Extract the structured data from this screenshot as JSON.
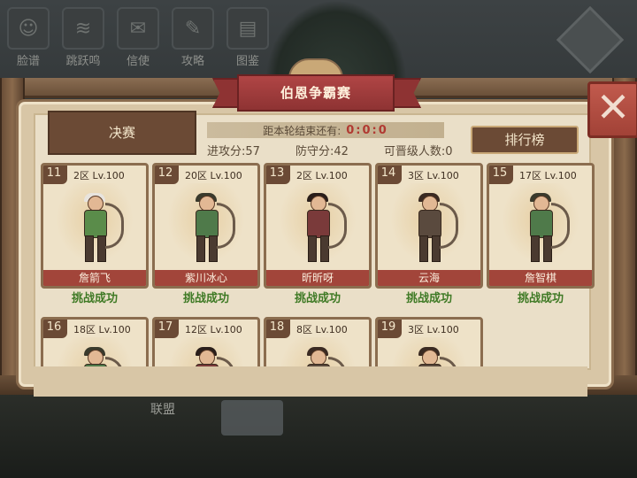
{
  "top_menu": [
    {
      "label": "脸谱",
      "icon": "mask-icon"
    },
    {
      "label": "跳跃鸣",
      "icon": "scroll-icon"
    },
    {
      "label": "信使",
      "icon": "letter-icon"
    },
    {
      "label": "攻略",
      "icon": "book-icon"
    },
    {
      "label": "图鉴",
      "icon": "album-icon"
    }
  ],
  "bottom_label": "联盟",
  "title": "伯恩争霸赛",
  "stage_tab": "决赛",
  "timer": {
    "label": "距本轮结束还有:",
    "value": "0:0:0"
  },
  "stats": {
    "attack": "进攻分:57",
    "defense": "防守分:42",
    "promotable": "可晋级人数:0"
  },
  "rank_button": "排行榜",
  "close_label": "✕",
  "cards": [
    {
      "num": "11",
      "server": "2区 Lv.100",
      "name": "詹箭飞",
      "status": "挑战成功",
      "hair": "#e8e4de",
      "outfit": "#5a8c4a"
    },
    {
      "num": "12",
      "server": "20区 Lv.100",
      "name": "紫川冰心",
      "status": "挑战成功",
      "hair": "#3a3a2c",
      "outfit": "#4f7a4a"
    },
    {
      "num": "13",
      "server": "2区 Lv.100",
      "name": "昕昕呀",
      "status": "挑战成功",
      "hair": "#2a1e1a",
      "outfit": "#7a3a3a"
    },
    {
      "num": "14",
      "server": "3区 Lv.100",
      "name": "云海",
      "status": "挑战成功",
      "hair": "#3a2a22",
      "outfit": "#5a4a3e"
    },
    {
      "num": "15",
      "server": "17区 Lv.100",
      "name": "詹智棋",
      "status": "挑战成功",
      "hair": "#3a3a2c",
      "outfit": "#4f7a4a"
    },
    {
      "num": "16",
      "server": "18区 Lv.100",
      "name": "",
      "status": "",
      "hair": "#3a3a2c",
      "outfit": "#4f7a4a"
    },
    {
      "num": "17",
      "server": "12区 Lv.100",
      "name": "",
      "status": "",
      "hair": "#2a1e1a",
      "outfit": "#7a3a3a"
    },
    {
      "num": "18",
      "server": "8区 Lv.100",
      "name": "",
      "status": "",
      "hair": "#3a2a22",
      "outfit": "#5a4a3e"
    },
    {
      "num": "19",
      "server": "3区 Lv.100",
      "name": "",
      "status": "",
      "hair": "#3a2a22",
      "outfit": "#5a4a3e"
    }
  ]
}
